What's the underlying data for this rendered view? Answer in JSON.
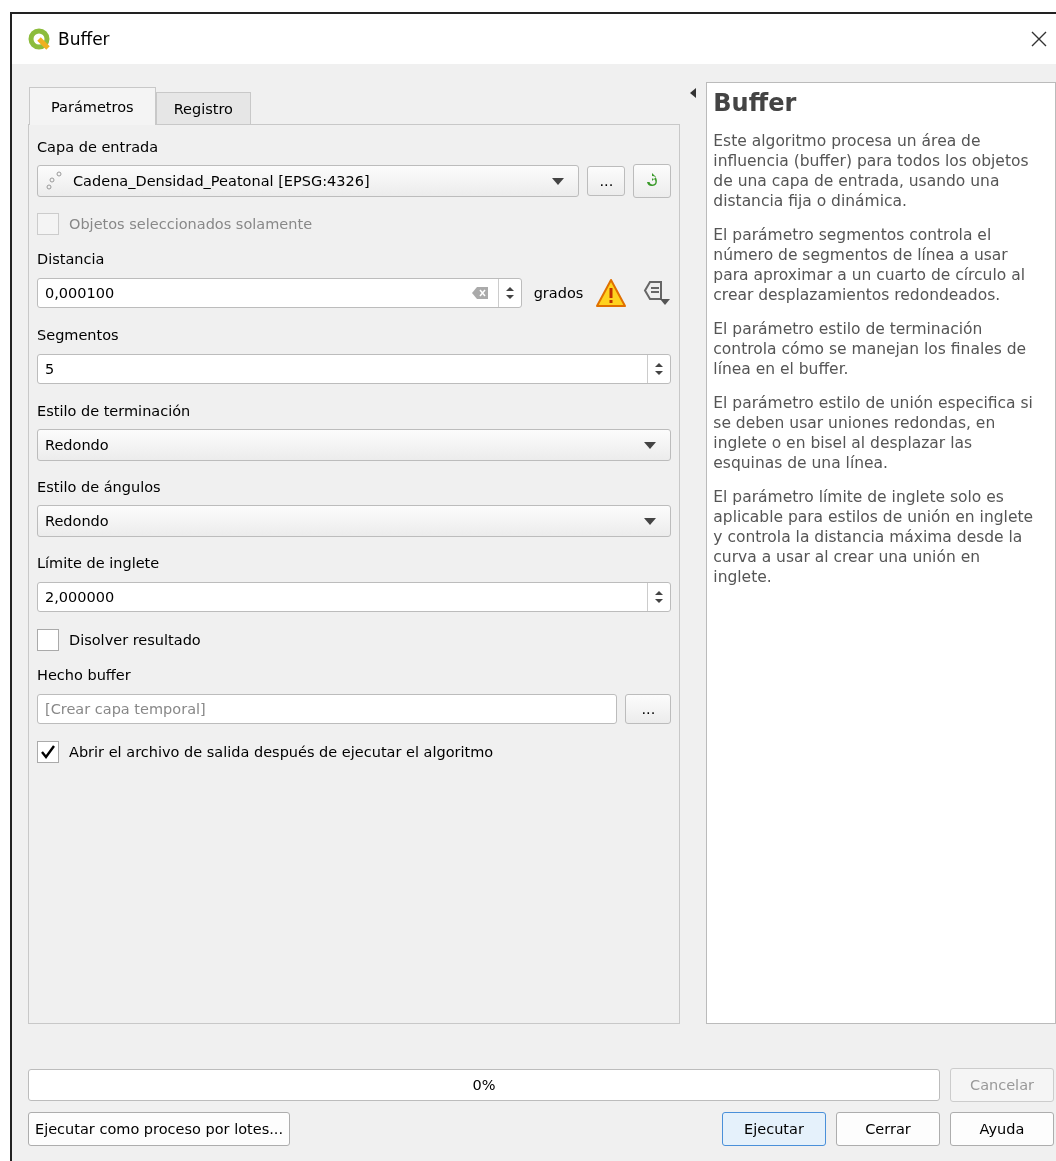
{
  "window": {
    "title": "Buffer"
  },
  "tabs": [
    {
      "label": "Parámetros",
      "selected": true
    },
    {
      "label": "Registro",
      "selected": false
    }
  ],
  "parameters": [
    {
      "kind": "layer",
      "label": "Capa de entrada",
      "value": "Cadena_Densidad_Peatonal [EPSG:4326]",
      "button": "..."
    },
    {
      "kind": "checkbox",
      "label": "Objetos seleccionados solamente",
      "checked": false,
      "disabled": true
    },
    {
      "kind": "distance",
      "label": "Distancia",
      "value": "0,000100",
      "unit": "grados"
    },
    {
      "kind": "spin",
      "label": "Segmentos",
      "value": "5"
    },
    {
      "kind": "combo",
      "label": "Estilo de terminación",
      "value": "Redondo"
    },
    {
      "kind": "combo",
      "label": "Estilo de ángulos",
      "value": "Redondo"
    },
    {
      "kind": "spin",
      "label": "Límite de inglete",
      "value": "2,000000"
    },
    {
      "kind": "checkbox",
      "label": "Disolver resultado",
      "checked": false,
      "disabled": false
    },
    {
      "kind": "output",
      "label": "Hecho buffer",
      "placeholder": "[Crear capa temporal]",
      "button": "..."
    },
    {
      "kind": "checkbox",
      "label": "Abrir el archivo de salida después de ejecutar el algoritmo",
      "checked": true,
      "disabled": false
    }
  ],
  "help": {
    "title": "Buffer",
    "paragraphs": [
      "Este algoritmo procesa un área de influencia (buffer) para todos los objetos de una capa de entrada, usando una distancia fija o dinámica.",
      "El parámetro segmentos controla el número de segmentos de línea a usar para aproximar a un cuarto de círculo al crear desplazamientos redondeados.",
      "El parámetro estilo de terminación controla cómo se manejan los finales de línea en el buffer.",
      "El parámetro estilo de unión especifica si se deben usar uniones redondas, en inglete o en bisel al desplazar las esquinas de una línea.",
      "El parámetro límite de inglete solo es aplicable para estilos de unión en inglete y controla la distancia máxima desde la curva a usar al crear una unión en inglete."
    ]
  },
  "progress": {
    "level": 0,
    "reading": "0%"
  },
  "cancel_button": {
    "label": "Cancelar",
    "disabled": true
  },
  "batch_button": "Ejecutar como proceso por lotes...",
  "buttons": [
    {
      "label": "Ejecutar",
      "default": true
    },
    {
      "label": "Cerrar",
      "default": false
    },
    {
      "label": "Ayuda",
      "default": false
    }
  ]
}
